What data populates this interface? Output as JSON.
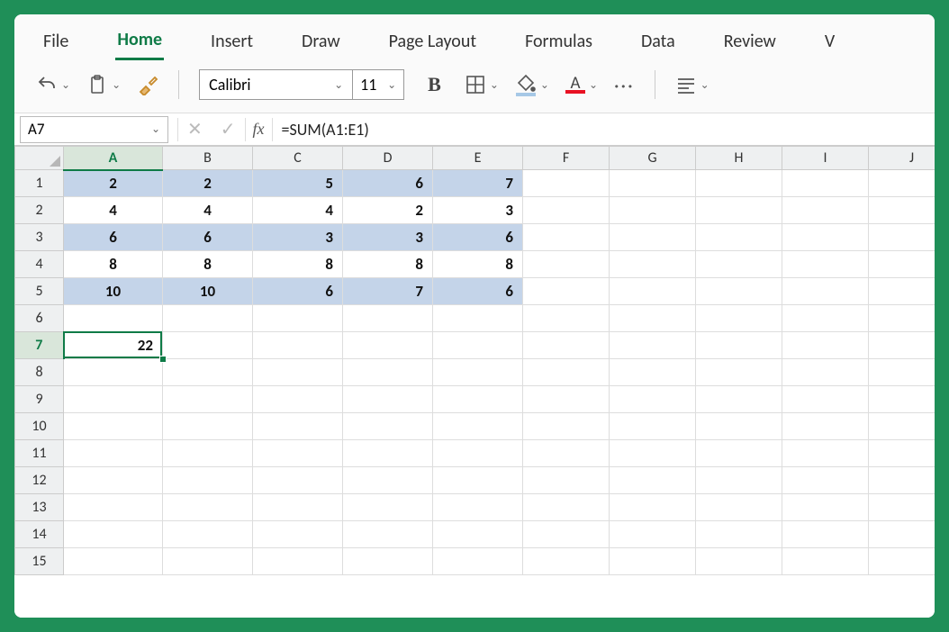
{
  "tabs": [
    "File",
    "Home",
    "Insert",
    "Draw",
    "Page Layout",
    "Formulas",
    "Data",
    "Review",
    "V"
  ],
  "active_tab": "Home",
  "toolbar": {
    "font_name": "Calibri",
    "font_size": "11",
    "bold": "B",
    "font_color_bar": "#e81123",
    "fill_color_bar": "#a6c8e6",
    "font_letter": "A"
  },
  "name_box": "A7",
  "formula": "=SUM(A1:E1)",
  "columns": [
    "A",
    "B",
    "C",
    "D",
    "E",
    "F",
    "G",
    "H",
    "I",
    "J"
  ],
  "active_col": "A",
  "rows": [
    1,
    2,
    3,
    4,
    5,
    6,
    7,
    8,
    9,
    10,
    11,
    12,
    13,
    14,
    15
  ],
  "active_row": 7,
  "cells": {
    "r1": {
      "A": "2",
      "B": "2",
      "C": "5",
      "D": "6",
      "E": "7"
    },
    "r2": {
      "A": "4",
      "B": "4",
      "C": "4",
      "D": "2",
      "E": "3"
    },
    "r3": {
      "A": "6",
      "B": "6",
      "C": "3",
      "D": "3",
      "E": "6"
    },
    "r4": {
      "A": "8",
      "B": "8",
      "C": "8",
      "D": "8",
      "E": "8"
    },
    "r5": {
      "A": "10",
      "B": "10",
      "C": "6",
      "D": "7",
      "E": "6"
    },
    "r7": {
      "A": "22"
    }
  },
  "shaded_rows": [
    1,
    3,
    5
  ],
  "data_region": {
    "rows": [
      1,
      2,
      3,
      4,
      5
    ],
    "cols": [
      "A",
      "B",
      "C",
      "D",
      "E"
    ]
  },
  "centered_cols": [
    "A",
    "B"
  ],
  "selection": {
    "cell": "A7"
  }
}
